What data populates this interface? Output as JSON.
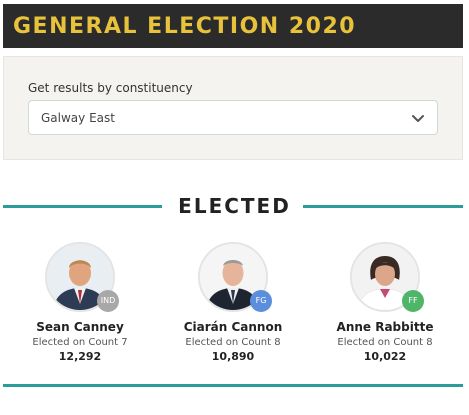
{
  "header": {
    "title": "GENERAL ELECTION 2020"
  },
  "filter": {
    "label": "Get results by constituency",
    "selected": "Galway East",
    "icon": "chevron-down-icon"
  },
  "section": {
    "title": "ELECTED"
  },
  "colors": {
    "header_bg": "#2b2b2b",
    "header_text": "#e8c23b",
    "accent": "#2a9d98",
    "ind": "#a8a8a8",
    "fg": "#5b8fdb",
    "ff": "#4fb569"
  },
  "candidates": [
    {
      "name": "Sean Canney",
      "status": "Elected on Count 7",
      "votes": "12,292",
      "party": "IND"
    },
    {
      "name": "Ciarán Cannon",
      "status": "Elected on Count 8",
      "votes": "10,890",
      "party": "FG"
    },
    {
      "name": "Anne Rabbitte",
      "status": "Elected on Count 8",
      "votes": "10,022",
      "party": "FF"
    }
  ]
}
